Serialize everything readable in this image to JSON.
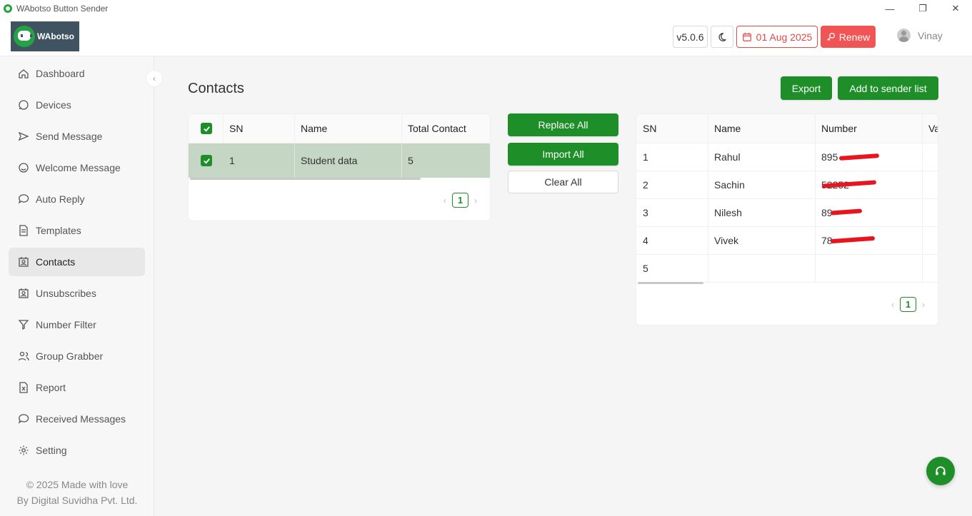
{
  "window": {
    "title": "WAbotso Button Sender"
  },
  "header": {
    "logo_text": "WAbotso",
    "version": "v5.0.6",
    "expiry_date": "01 Aug 2025",
    "renew_label": "Renew",
    "user_name": "Vinay"
  },
  "sidebar": {
    "items": [
      {
        "label": "Dashboard",
        "icon": "home-icon"
      },
      {
        "label": "Devices",
        "icon": "whatsapp-icon"
      },
      {
        "label": "Send Message",
        "icon": "send-icon"
      },
      {
        "label": "Welcome Message",
        "icon": "smile-icon"
      },
      {
        "label": "Auto Reply",
        "icon": "chat-icon"
      },
      {
        "label": "Templates",
        "icon": "file-icon"
      },
      {
        "label": "Contacts",
        "icon": "contacts-icon"
      },
      {
        "label": "Unsubscribes",
        "icon": "contacts-icon"
      },
      {
        "label": "Number Filter",
        "icon": "filter-icon"
      },
      {
        "label": "Group Grabber",
        "icon": "user-group-icon"
      },
      {
        "label": "Report",
        "icon": "excel-icon"
      },
      {
        "label": "Received Messages",
        "icon": "chat-icon"
      },
      {
        "label": "Setting",
        "icon": "gear-icon"
      }
    ],
    "active_index": 6,
    "footer_line1": "© 2025 Made with love",
    "footer_line2": "By Digital Suvidha Pvt. Ltd."
  },
  "main": {
    "title": "Contacts",
    "export_label": "Export",
    "add_sender_label": "Add to sender list",
    "replace_all_label": "Replace All",
    "import_all_label": "Import All",
    "clear_all_label": "Clear All",
    "groups_table": {
      "columns": [
        "SN",
        "Name",
        "Total Contact"
      ],
      "rows": [
        {
          "sn": "1",
          "name": "Student data",
          "total": "5"
        }
      ],
      "page": "1"
    },
    "contacts_table": {
      "columns": [
        "SN",
        "Name",
        "Number",
        "Va"
      ],
      "rows": [
        {
          "sn": "1",
          "name": "Rahul",
          "number": "895"
        },
        {
          "sn": "2",
          "name": "Sachin",
          "number": "52252"
        },
        {
          "sn": "3",
          "name": "Nilesh",
          "number": "89"
        },
        {
          "sn": "4",
          "name": "Vivek",
          "number": "78"
        },
        {
          "sn": "5",
          "name": "",
          "number": ""
        }
      ],
      "page": "1"
    }
  },
  "colors": {
    "accent": "#1e8e28",
    "danger": "#f05454",
    "sidebar_active": "#e8e8e8"
  }
}
